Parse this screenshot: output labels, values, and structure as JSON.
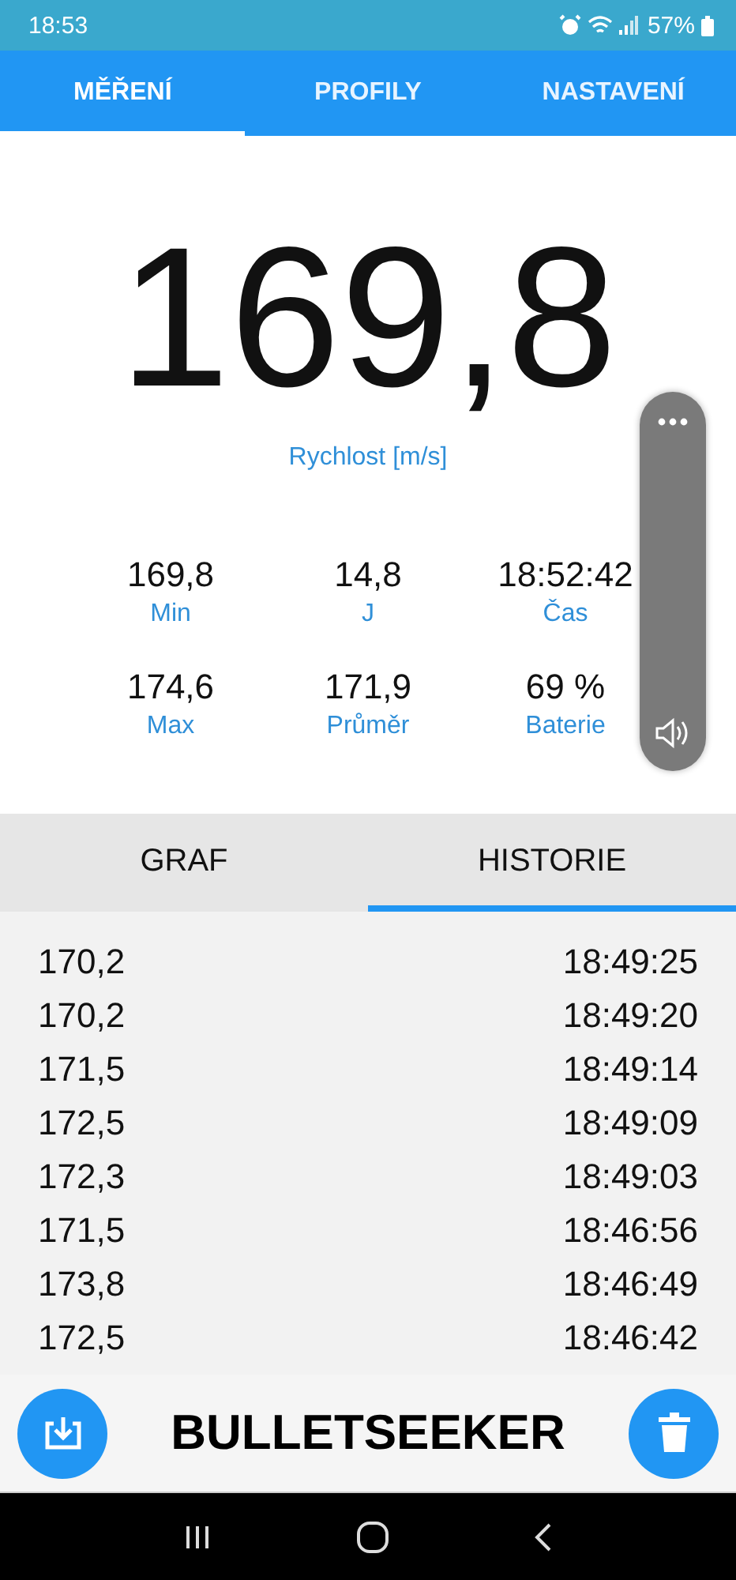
{
  "status_bar": {
    "time": "18:53",
    "battery": "57%"
  },
  "tabs": [
    {
      "label": "MĚŘENÍ",
      "selected": true
    },
    {
      "label": "PROFILY",
      "selected": false
    },
    {
      "label": "NASTAVENÍ",
      "selected": false
    }
  ],
  "measurement": {
    "value": "169,8",
    "label": "Rychlost [m/s]"
  },
  "stats": [
    {
      "value": "169,8",
      "label": "Min"
    },
    {
      "value": "14,8",
      "label": "J"
    },
    {
      "value": "18:52:42",
      "label": "Čas"
    },
    {
      "value": "174,6",
      "label": "Max"
    },
    {
      "value": "171,9",
      "label": "Průměr"
    },
    {
      "value": "69 %",
      "label": "Baterie"
    }
  ],
  "subtabs": [
    {
      "label": "GRAF",
      "selected": false
    },
    {
      "label": "HISTORIE",
      "selected": true
    }
  ],
  "history": [
    {
      "value": "170,2",
      "time": "18:49:25"
    },
    {
      "value": "170,2",
      "time": "18:49:20"
    },
    {
      "value": "171,5",
      "time": "18:49:14"
    },
    {
      "value": "172,5",
      "time": "18:49:09"
    },
    {
      "value": "172,3",
      "time": "18:49:03"
    },
    {
      "value": "171,5",
      "time": "18:46:56"
    },
    {
      "value": "173,8",
      "time": "18:46:49"
    },
    {
      "value": "172,5",
      "time": "18:46:42"
    }
  ],
  "footer": {
    "title": "BULLETSEEKER"
  }
}
